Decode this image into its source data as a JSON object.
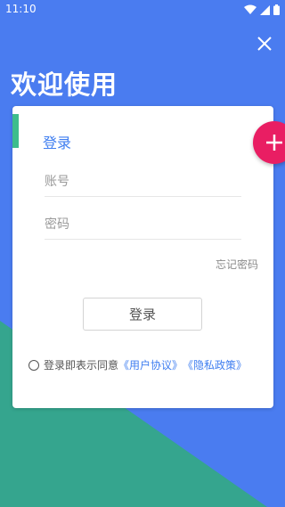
{
  "colors": {
    "background_blue": "#4a7cf0",
    "background_green": "#35a58e",
    "accent_blue": "#3f7ef0",
    "accent_green": "#3dbd8c",
    "fab_pink": "#e91e63"
  },
  "status_bar": {
    "time": "11:10",
    "icons": [
      "wifi-icon",
      "signal-icon",
      "battery-icon"
    ]
  },
  "header": {
    "close_icon": "close-icon",
    "welcome_title": "欢迎使用"
  },
  "login_card": {
    "title": "登录",
    "account_placeholder": "账号",
    "account_value": "",
    "password_placeholder": "密码",
    "password_value": "",
    "forgot_password": "忘记密码",
    "login_button": "登录",
    "agreement": {
      "prefix": "登录即表示同意",
      "user_agreement": "《用户协议》",
      "privacy_policy": "《隐私政策》",
      "checked": false
    }
  },
  "fab": {
    "icon": "plus-icon"
  }
}
